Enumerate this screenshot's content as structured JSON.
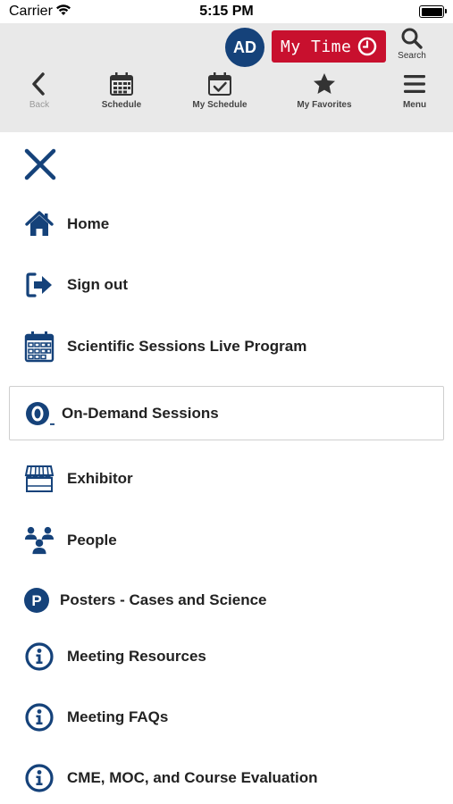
{
  "status_bar": {
    "carrier": "Carrier",
    "time": "5:15 PM"
  },
  "header": {
    "avatar_initials": "AD",
    "my_time_label": "My Time",
    "search_label": "Search",
    "toolbar": {
      "back": "Back",
      "schedule": "Schedule",
      "my_schedule": "My Schedule",
      "my_favorites": "My Favorites",
      "menu": "Menu"
    }
  },
  "menu": {
    "items": [
      {
        "label": "Home",
        "icon": "home-icon"
      },
      {
        "label": "Sign out",
        "icon": "sign-out-icon"
      },
      {
        "label": "Scientific Sessions Live Program",
        "icon": "calendar-icon"
      },
      {
        "label": "On-Demand Sessions",
        "icon": "on-demand-icon",
        "selected": true
      },
      {
        "label": "Exhibitor",
        "icon": "storefront-icon"
      },
      {
        "label": "People",
        "icon": "people-icon"
      },
      {
        "label": "Posters - Cases and Science",
        "icon": "posters-p-icon"
      },
      {
        "label": "Meeting Resources",
        "icon": "info-icon"
      },
      {
        "label": "Meeting FAQs",
        "icon": "info-icon"
      },
      {
        "label": "CME, MOC, and Course Evaluation",
        "icon": "info-icon"
      }
    ]
  },
  "colors": {
    "brand_navy": "#15427a",
    "my_time_red": "#c8102e",
    "header_bg": "#e9e9e9"
  }
}
